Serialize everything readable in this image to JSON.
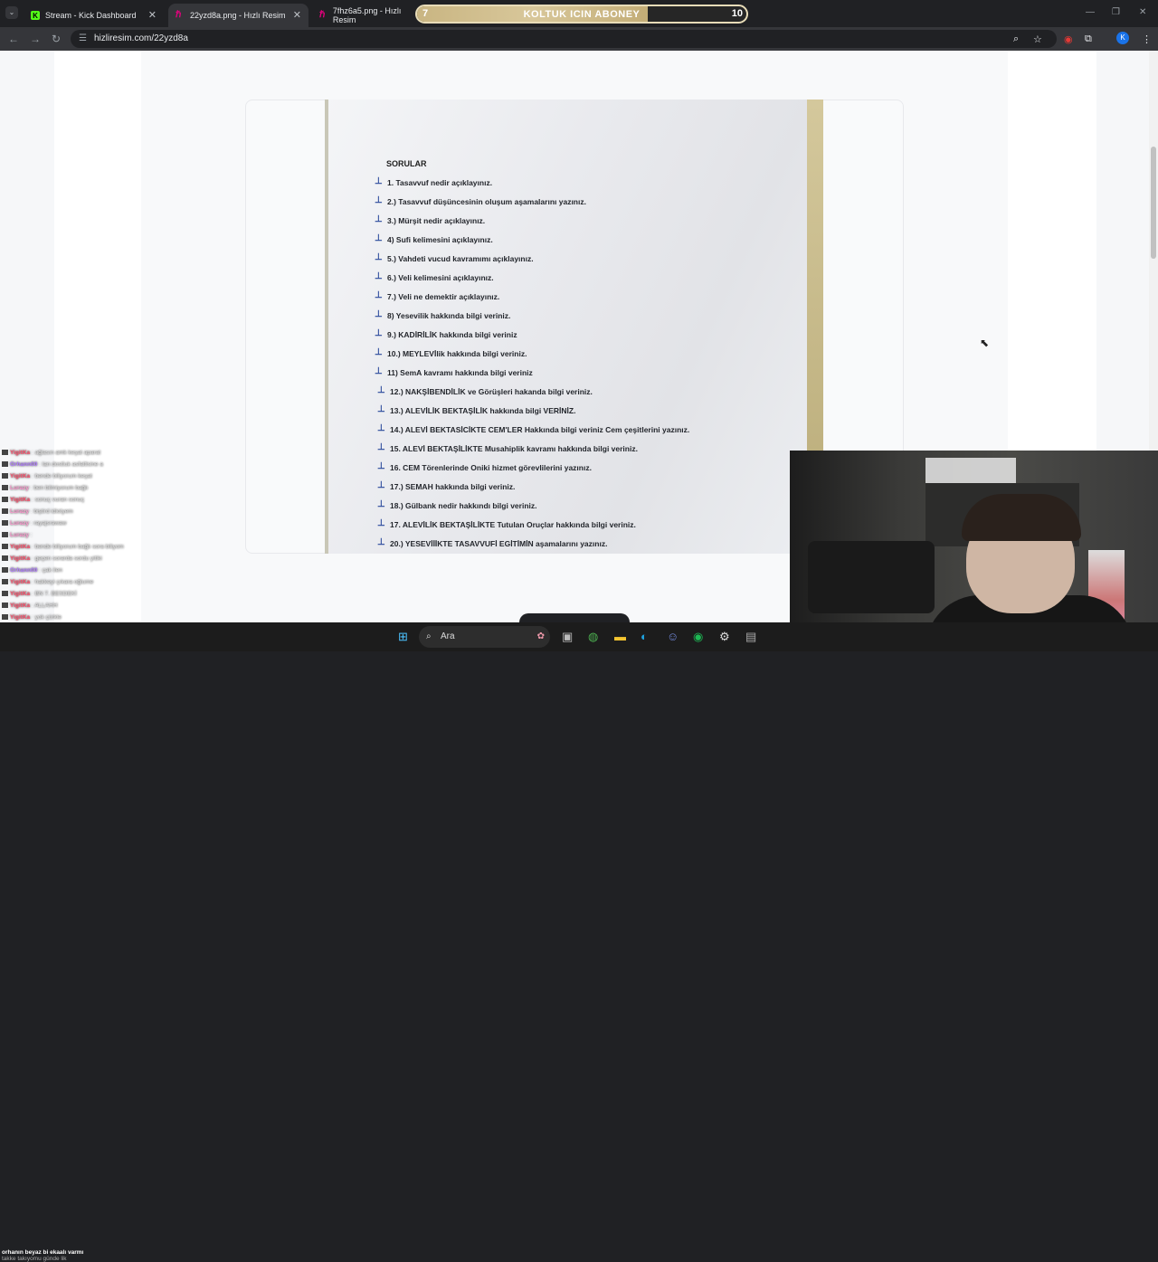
{
  "browser": {
    "tab_list_icon": "chevron-down-icon",
    "tabs": [
      {
        "label": "Stream - Kick Dashboard",
        "favicon": "kick-logo"
      },
      {
        "label": "22yzd8a.png - Hızlı Resim",
        "favicon": "hizliresim-logo"
      },
      {
        "label": "7fhz6a5.png - Hızlı Resim",
        "favicon": "hizliresim-logo"
      }
    ],
    "url": "hizliresim.com/22yzd8a",
    "avatar_letter": "K"
  },
  "overlay_banner": {
    "left_number": "7",
    "text": "KOLTUK ICIN ABONEY",
    "right_number": "10",
    "progress": 0.7,
    "accent": "#c9b582"
  },
  "document": {
    "title": "SORULAR",
    "questions": [
      "1. Tasavvuf nedir açıklayınız.",
      "2.) Tasavvuf  düşüncesinin oluşum aşamalarını yazınız.",
      "3.) Mürşit nedir açıklayınız.",
      "4) Sufi kelimesini açıklayınız.",
      "5.) Vahdeti vucud kavramımı açıklayınız.",
      "6.) Veli kelimesini açıklayınız.",
      "7.) Veli ne demektir açıklayınız.",
      "8) Yesevilik hakkında bilgi veriniz.",
      "9.) KADİRİLİK hakkında bilgi veriniz",
      "10.) MEYLEVİlik hakkında bilgi veriniz.",
      "11) SemA kavramı hakkında bilgi veriniz",
      "12.) NAKŞİBENDİLİK ve Görüşleri hakanda bilgi veriniz.",
      "13.) ALEVİLİK BEKTAŞİLİK hakkında bilgi VERİNİZ.",
      "14.) ALEVİ BEKTASİCİKTE CEM'LER Hakkında bilgi veriniz Cem çeşitlerini yazınız.",
      "15. ALEVİ BEKTAŞİLİKTE Musahiplik kavramı hakkında bilgi veriniz.",
      "16. CEM Törenlerinde Oniki hizmet görevlilerini yazınız.",
      "17.) SEMAH hakkında bilgi veriniz.",
      "18.) Gülbank nedir hakkındı bilgi veriniz.",
      "17. ALEVİLİK BEKTAŞİLİKTE Tutulan Oruçlar hakkında bilgi veriniz.",
      "20.) YESEVİİİKTE TASAVVUFİ EGİTİMİN aşamalarını yazınız."
    ]
  },
  "chat": {
    "messages": [
      {
        "user": "YigitKa",
        "text": "ağlasın amk keşat aparat",
        "color": "#ff4d6a"
      },
      {
        "user": "Orhann00",
        "text": "lan dostluk asfaltlsine a",
        "color": "#b07cff"
      },
      {
        "user": "YigitKa",
        "text": "bende biliyorum keşat",
        "color": "#ff4d6a"
      },
      {
        "user": "Lurazy",
        "text": "ben bilmiyorum bağlı",
        "color": "#ff9bd1"
      },
      {
        "user": "YigitKa",
        "text": "sonuç vuran sonuç",
        "color": "#ff4d6a"
      },
      {
        "user": "Lurazy",
        "text": "biştird idiotyem",
        "color": "#ff9bd1"
      },
      {
        "user": "Lurazy",
        "text": "rayajsrawaw",
        "color": "#ff9bd1"
      },
      {
        "user": "Lurazy",
        "text": "",
        "color": "#ff9bd1"
      },
      {
        "user": "YigitKa",
        "text": "bende biliyorum bağlı sora biliyom",
        "color": "#ff4d6a"
      },
      {
        "user": "YigitKa",
        "text": "geçen sorarda sordu yitiki",
        "color": "#ff4d6a"
      },
      {
        "user": "Orhann00",
        "text": "çak ilen",
        "color": "#b07cff"
      },
      {
        "user": "YigitKa",
        "text": "hakkeyi çıkara oğlume",
        "color": "#ff4d6a"
      },
      {
        "user": "YigitKa",
        "text": "BN 7. BESDEKİ",
        "color": "#ff4d6a"
      },
      {
        "user": "YigitKa",
        "text": "ALLAHH",
        "color": "#ff4d6a"
      },
      {
        "user": "YigitKa",
        "text": "yok çürkle",
        "color": "#ff4d6a"
      }
    ],
    "pinned_user": "",
    "pinned_text": "orhanın beyaz bi ekaalı varmı",
    "pinned_sub": "takke takıyomu günde lik"
  },
  "taskbar": {
    "search_label": "Ara",
    "icons": [
      "windows-start-icon",
      "search-icon",
      "task-view-icon",
      "chrome-icon",
      "file-explorer-icon",
      "edge-icon",
      "discord-icon",
      "spotify-icon",
      "steam-icon",
      "app-icon"
    ]
  }
}
